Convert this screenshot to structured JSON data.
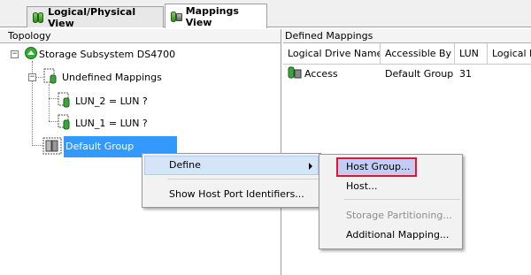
{
  "tabs": [
    {
      "label": "Logical/Physical View",
      "active": false
    },
    {
      "label": "Mappings View",
      "active": true
    }
  ],
  "topology": {
    "header": "Topology",
    "root": "Storage Subsystem DS4700",
    "undefined_mappings": "Undefined Mappings",
    "lun2": "LUN_2 = LUN ?",
    "lun1": "LUN_1 = LUN ?",
    "default_group": "Default Group"
  },
  "mappings": {
    "header": "Defined Mappings",
    "columns": [
      "Logical Drive Name",
      "Accessible By",
      "LUN",
      "Logical D"
    ],
    "rows": [
      {
        "name": "Access",
        "accessible_by": "Default Group",
        "lun": "31"
      }
    ]
  },
  "context_menu": {
    "define": "Define",
    "show_host_port": "Show Host Port Identifiers..."
  },
  "submenu": {
    "host_group": "Host Group...",
    "host": "Host...",
    "storage_partitioning": "Storage Partitioning...",
    "additional_mapping": "Additional Mapping..."
  },
  "colors": {
    "selection": "#3399ff",
    "focus_outline": "#e0172f",
    "menu_background": "#f2f2f2"
  }
}
